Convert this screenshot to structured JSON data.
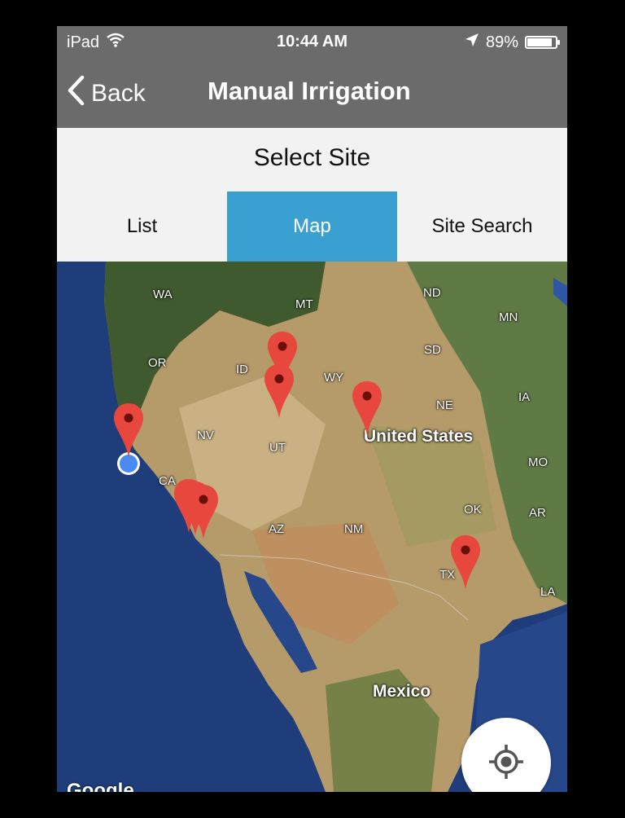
{
  "status_bar": {
    "device": "iPad",
    "time": "10:44 AM",
    "battery": "89%",
    "battery_level": 0.89
  },
  "nav": {
    "back_label": "Back",
    "title": "Manual Irrigation"
  },
  "header": {
    "title": "Select Site"
  },
  "tabs": [
    {
      "label": "List",
      "active": false
    },
    {
      "label": "Map",
      "active": true
    },
    {
      "label": "Site Search",
      "active": false
    }
  ],
  "map": {
    "labels": {
      "wa": "WA",
      "mt": "MT",
      "nd": "ND",
      "mn": "MN",
      "or": "OR",
      "id": "ID",
      "wy": "WY",
      "sd": "SD",
      "ne": "NE",
      "ia": "IA",
      "nv": "NV",
      "ut": "UT",
      "us": "United States",
      "ca": "CA",
      "mo": "MO",
      "ok": "OK",
      "ar": "AR",
      "az": "AZ",
      "nm": "NM",
      "tx": "TX",
      "la": "LA",
      "mexico": "Mexico"
    },
    "provider": "Google"
  },
  "colors": {
    "bar_bg": "#6b6b6b",
    "accent": "#3aa0d2",
    "pin": "#e8473d",
    "location_dot": "#4a8af4"
  }
}
